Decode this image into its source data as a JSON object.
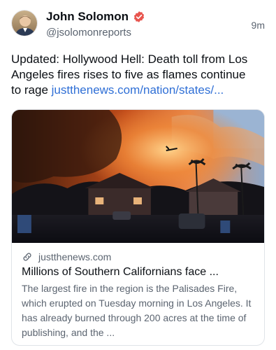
{
  "author": {
    "display_name": "John Solomon",
    "handle": "@jsolomonreports",
    "verified_color": "#e8554e",
    "avatar_icon": "person-avatar"
  },
  "post": {
    "time": "9m",
    "text": "Updated: Hollywood Hell: Death toll from Los Angeles fires rises to five as flames continue to rage ",
    "link_text": "justthenews.com/nation/states/..."
  },
  "card": {
    "domain": "justthenews.com",
    "title": "Millions of Southern Californians face ...",
    "description": "The largest fire in the region is the Palisades Fire, which erupted on Tuesday morning in Los Angeles. It has already burned through 200 acres at the time of publishing, and the ...",
    "image_subject": "wildfire-smoke-over-neighborhood-with-helicopter"
  },
  "colors": {
    "link": "#2f6fd6",
    "secondary_text": "#5b6470",
    "border": "#dfe3e8"
  }
}
